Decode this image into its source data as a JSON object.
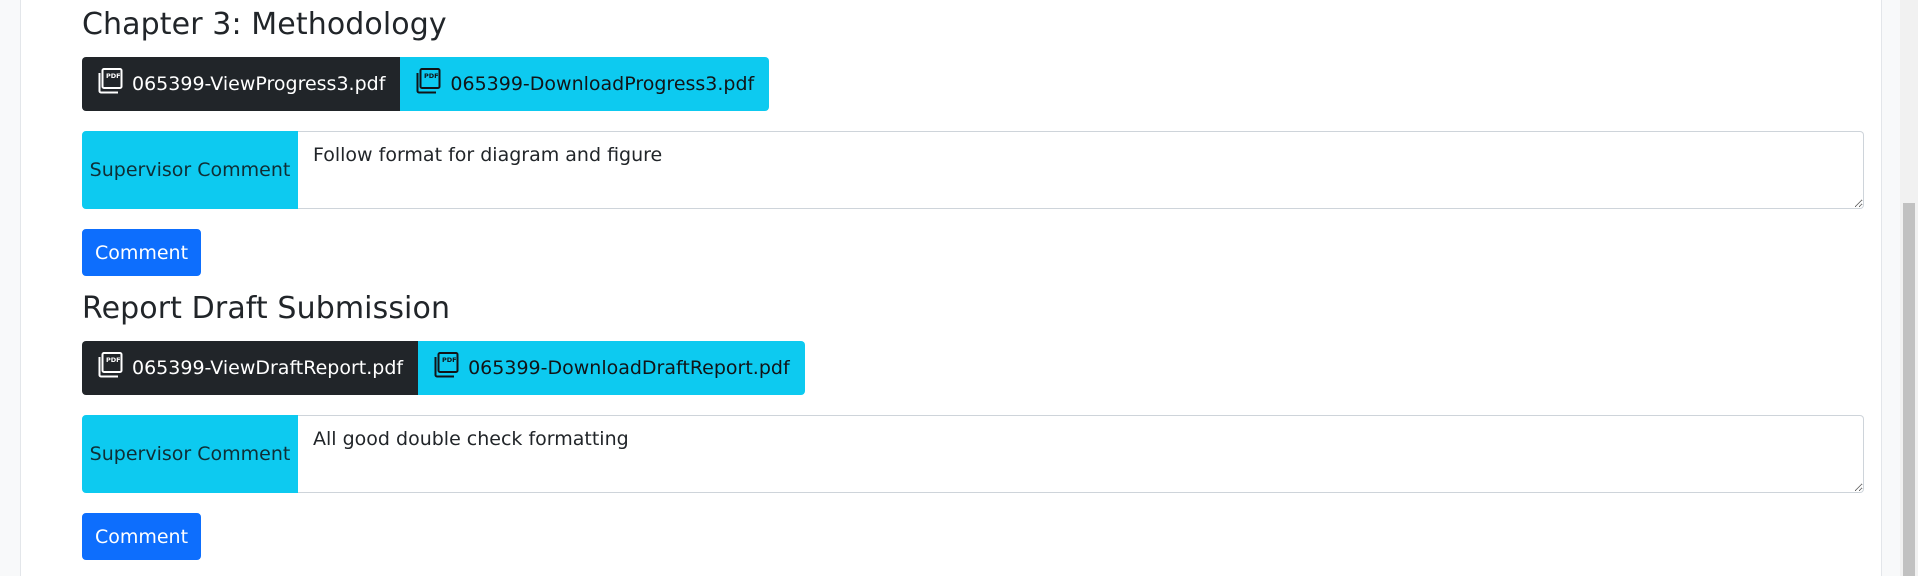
{
  "sections": [
    {
      "title": "Chapter 3: Methodology",
      "view_file_label": "065399-ViewProgress3.pdf",
      "download_file_label": "065399-DownloadProgress3.pdf",
      "comment_label": "Supervisor Comment",
      "comment_value": "Follow format for diagram and figure",
      "comment_button_label": "Comment"
    },
    {
      "title": "Report Draft Submission",
      "view_file_label": "065399-ViewDraftReport.pdf",
      "download_file_label": "065399-DownloadDraftReport.pdf",
      "comment_label": "Supervisor Comment",
      "comment_value": "All good double check formatting",
      "comment_button_label": "Comment"
    }
  ],
  "icons": {
    "file_icon": "pdf-files-icon"
  },
  "colors": {
    "dark_button": "#212529",
    "info_button": "#0dcaf0",
    "primary_button": "#0d6efd"
  }
}
